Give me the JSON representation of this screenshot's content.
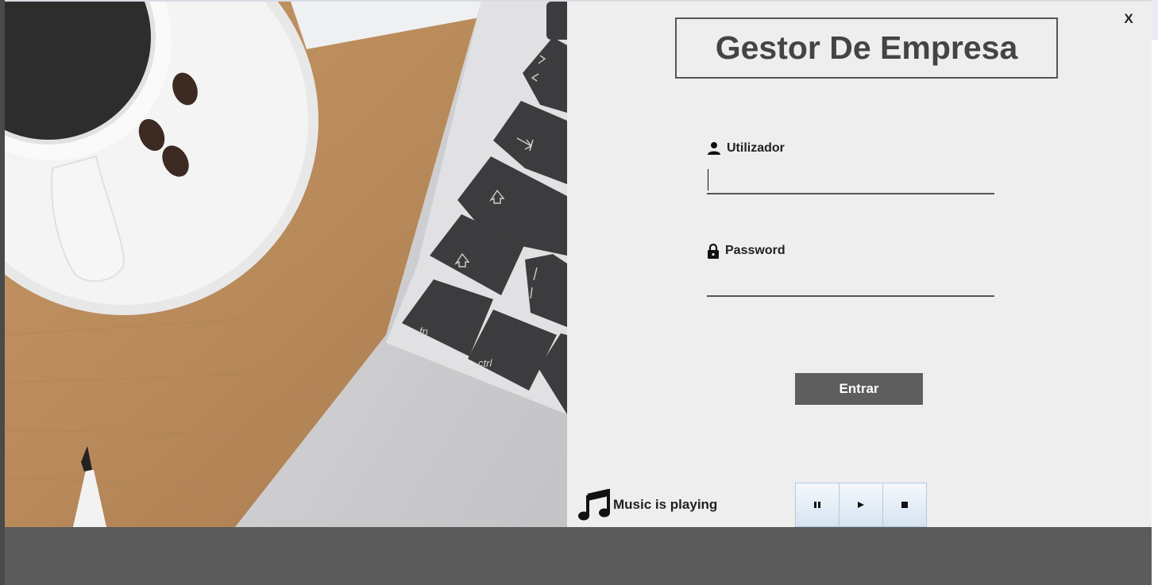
{
  "app": {
    "title": "Gestor De Empresa",
    "close_label": "X"
  },
  "form": {
    "username_label": "Utilizador",
    "username_value": "",
    "password_label": "Password",
    "password_value": "",
    "submit_label": "Entrar"
  },
  "music": {
    "status_text": "Music is playing",
    "controls": [
      "pause-icon",
      "play-icon",
      "stop-icon"
    ]
  },
  "colors": {
    "panel_bg": "#eeeeee",
    "button_bg": "#5e5e5e",
    "bottom_bar": "#5b5b5b"
  }
}
